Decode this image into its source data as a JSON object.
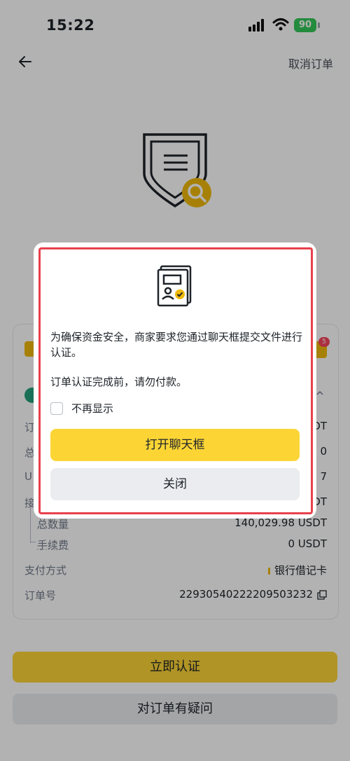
{
  "status": {
    "time": "15:22",
    "battery": "90"
  },
  "nav": {
    "cancel_label": "取消订单"
  },
  "card": {
    "badge_count": "5",
    "rows": [
      {
        "label": "订",
        "value": "DT"
      },
      {
        "label": "总",
        "value": "0"
      },
      {
        "label": "U",
        "value": "7"
      },
      {
        "label": "接",
        "value": "DT"
      }
    ],
    "total_qty": {
      "label": "总数量",
      "value": "140,029.98 USDT"
    },
    "fee": {
      "label": "手续费",
      "value": "0 USDT"
    },
    "payment": {
      "label": "支付方式",
      "value": "银行借记卡"
    },
    "order_no": {
      "label": "订单号",
      "value": "22930540222209503232"
    }
  },
  "buttons": {
    "verify": "立即认证",
    "question": "对订单有疑问"
  },
  "modal": {
    "message": "为确保资金安全，商家要求您通过聊天框提交文件进行认证。",
    "warning": "订单认证完成前，请勿付款。",
    "checkbox_label": "不再显示",
    "open_chat": "打开聊天框",
    "close": "关闭"
  },
  "colors": {
    "accent": "#fcd535",
    "highlight_border": "#e8414c",
    "badge": "#f6465d"
  }
}
